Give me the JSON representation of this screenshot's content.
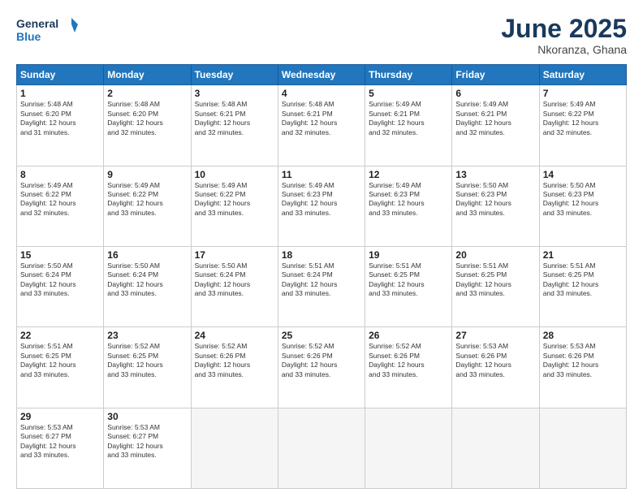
{
  "header": {
    "logo_line1": "General",
    "logo_line2": "Blue",
    "month": "June 2025",
    "location": "Nkoranza, Ghana"
  },
  "weekdays": [
    "Sunday",
    "Monday",
    "Tuesday",
    "Wednesday",
    "Thursday",
    "Friday",
    "Saturday"
  ],
  "weeks": [
    [
      {
        "day": "1",
        "lines": [
          "Sunrise: 5:48 AM",
          "Sunset: 6:20 PM",
          "Daylight: 12 hours",
          "and 31 minutes."
        ]
      },
      {
        "day": "2",
        "lines": [
          "Sunrise: 5:48 AM",
          "Sunset: 6:20 PM",
          "Daylight: 12 hours",
          "and 32 minutes."
        ]
      },
      {
        "day": "3",
        "lines": [
          "Sunrise: 5:48 AM",
          "Sunset: 6:21 PM",
          "Daylight: 12 hours",
          "and 32 minutes."
        ]
      },
      {
        "day": "4",
        "lines": [
          "Sunrise: 5:48 AM",
          "Sunset: 6:21 PM",
          "Daylight: 12 hours",
          "and 32 minutes."
        ]
      },
      {
        "day": "5",
        "lines": [
          "Sunrise: 5:49 AM",
          "Sunset: 6:21 PM",
          "Daylight: 12 hours",
          "and 32 minutes."
        ]
      },
      {
        "day": "6",
        "lines": [
          "Sunrise: 5:49 AM",
          "Sunset: 6:21 PM",
          "Daylight: 12 hours",
          "and 32 minutes."
        ]
      },
      {
        "day": "7",
        "lines": [
          "Sunrise: 5:49 AM",
          "Sunset: 6:22 PM",
          "Daylight: 12 hours",
          "and 32 minutes."
        ]
      }
    ],
    [
      {
        "day": "8",
        "lines": [
          "Sunrise: 5:49 AM",
          "Sunset: 6:22 PM",
          "Daylight: 12 hours",
          "and 32 minutes."
        ]
      },
      {
        "day": "9",
        "lines": [
          "Sunrise: 5:49 AM",
          "Sunset: 6:22 PM",
          "Daylight: 12 hours",
          "and 33 minutes."
        ]
      },
      {
        "day": "10",
        "lines": [
          "Sunrise: 5:49 AM",
          "Sunset: 6:22 PM",
          "Daylight: 12 hours",
          "and 33 minutes."
        ]
      },
      {
        "day": "11",
        "lines": [
          "Sunrise: 5:49 AM",
          "Sunset: 6:23 PM",
          "Daylight: 12 hours",
          "and 33 minutes."
        ]
      },
      {
        "day": "12",
        "lines": [
          "Sunrise: 5:49 AM",
          "Sunset: 6:23 PM",
          "Daylight: 12 hours",
          "and 33 minutes."
        ]
      },
      {
        "day": "13",
        "lines": [
          "Sunrise: 5:50 AM",
          "Sunset: 6:23 PM",
          "Daylight: 12 hours",
          "and 33 minutes."
        ]
      },
      {
        "day": "14",
        "lines": [
          "Sunrise: 5:50 AM",
          "Sunset: 6:23 PM",
          "Daylight: 12 hours",
          "and 33 minutes."
        ]
      }
    ],
    [
      {
        "day": "15",
        "lines": [
          "Sunrise: 5:50 AM",
          "Sunset: 6:24 PM",
          "Daylight: 12 hours",
          "and 33 minutes."
        ]
      },
      {
        "day": "16",
        "lines": [
          "Sunrise: 5:50 AM",
          "Sunset: 6:24 PM",
          "Daylight: 12 hours",
          "and 33 minutes."
        ]
      },
      {
        "day": "17",
        "lines": [
          "Sunrise: 5:50 AM",
          "Sunset: 6:24 PM",
          "Daylight: 12 hours",
          "and 33 minutes."
        ]
      },
      {
        "day": "18",
        "lines": [
          "Sunrise: 5:51 AM",
          "Sunset: 6:24 PM",
          "Daylight: 12 hours",
          "and 33 minutes."
        ]
      },
      {
        "day": "19",
        "lines": [
          "Sunrise: 5:51 AM",
          "Sunset: 6:25 PM",
          "Daylight: 12 hours",
          "and 33 minutes."
        ]
      },
      {
        "day": "20",
        "lines": [
          "Sunrise: 5:51 AM",
          "Sunset: 6:25 PM",
          "Daylight: 12 hours",
          "and 33 minutes."
        ]
      },
      {
        "day": "21",
        "lines": [
          "Sunrise: 5:51 AM",
          "Sunset: 6:25 PM",
          "Daylight: 12 hours",
          "and 33 minutes."
        ]
      }
    ],
    [
      {
        "day": "22",
        "lines": [
          "Sunrise: 5:51 AM",
          "Sunset: 6:25 PM",
          "Daylight: 12 hours",
          "and 33 minutes."
        ]
      },
      {
        "day": "23",
        "lines": [
          "Sunrise: 5:52 AM",
          "Sunset: 6:25 PM",
          "Daylight: 12 hours",
          "and 33 minutes."
        ]
      },
      {
        "day": "24",
        "lines": [
          "Sunrise: 5:52 AM",
          "Sunset: 6:26 PM",
          "Daylight: 12 hours",
          "and 33 minutes."
        ]
      },
      {
        "day": "25",
        "lines": [
          "Sunrise: 5:52 AM",
          "Sunset: 6:26 PM",
          "Daylight: 12 hours",
          "and 33 minutes."
        ]
      },
      {
        "day": "26",
        "lines": [
          "Sunrise: 5:52 AM",
          "Sunset: 6:26 PM",
          "Daylight: 12 hours",
          "and 33 minutes."
        ]
      },
      {
        "day": "27",
        "lines": [
          "Sunrise: 5:53 AM",
          "Sunset: 6:26 PM",
          "Daylight: 12 hours",
          "and 33 minutes."
        ]
      },
      {
        "day": "28",
        "lines": [
          "Sunrise: 5:53 AM",
          "Sunset: 6:26 PM",
          "Daylight: 12 hours",
          "and 33 minutes."
        ]
      }
    ],
    [
      {
        "day": "29",
        "lines": [
          "Sunrise: 5:53 AM",
          "Sunset: 6:27 PM",
          "Daylight: 12 hours",
          "and 33 minutes."
        ]
      },
      {
        "day": "30",
        "lines": [
          "Sunrise: 5:53 AM",
          "Sunset: 6:27 PM",
          "Daylight: 12 hours",
          "and 33 minutes."
        ]
      },
      {
        "day": "",
        "lines": []
      },
      {
        "day": "",
        "lines": []
      },
      {
        "day": "",
        "lines": []
      },
      {
        "day": "",
        "lines": []
      },
      {
        "day": "",
        "lines": []
      }
    ]
  ]
}
